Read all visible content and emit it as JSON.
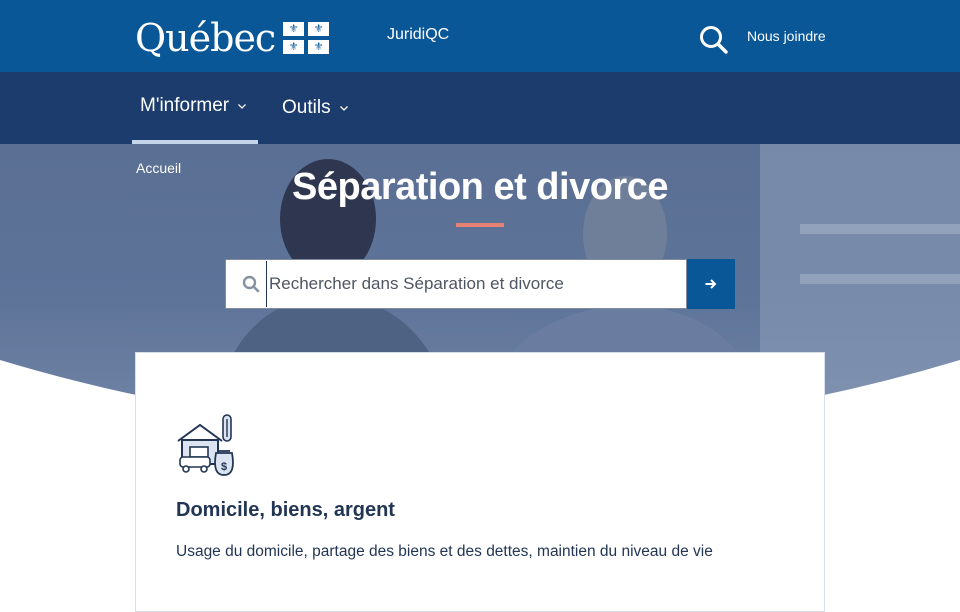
{
  "header": {
    "logo_text": "Québec",
    "site_name": "JuridiQC",
    "search_icon": "search-icon",
    "contact_label": "Nous joindre"
  },
  "nav": {
    "items": [
      {
        "label": "M'informer",
        "active": true
      },
      {
        "label": "Outils",
        "active": false
      }
    ]
  },
  "breadcrumb": {
    "home": "Accueil"
  },
  "hero": {
    "title": "Séparation et divorce",
    "search_placeholder": "Rechercher dans Séparation et divorce",
    "search_value": "",
    "submit_icon": "arrow-right-icon"
  },
  "card": {
    "icon": "house-money-icon",
    "title": "Domicile, biens, argent",
    "description": "Usage du domicile, partage des biens et des dettes, maintien du niveau de vie"
  },
  "colors": {
    "header_bg": "#095797",
    "nav_bg": "#1b3c6c",
    "accent": "#e58271",
    "text_dark": "#223654"
  }
}
